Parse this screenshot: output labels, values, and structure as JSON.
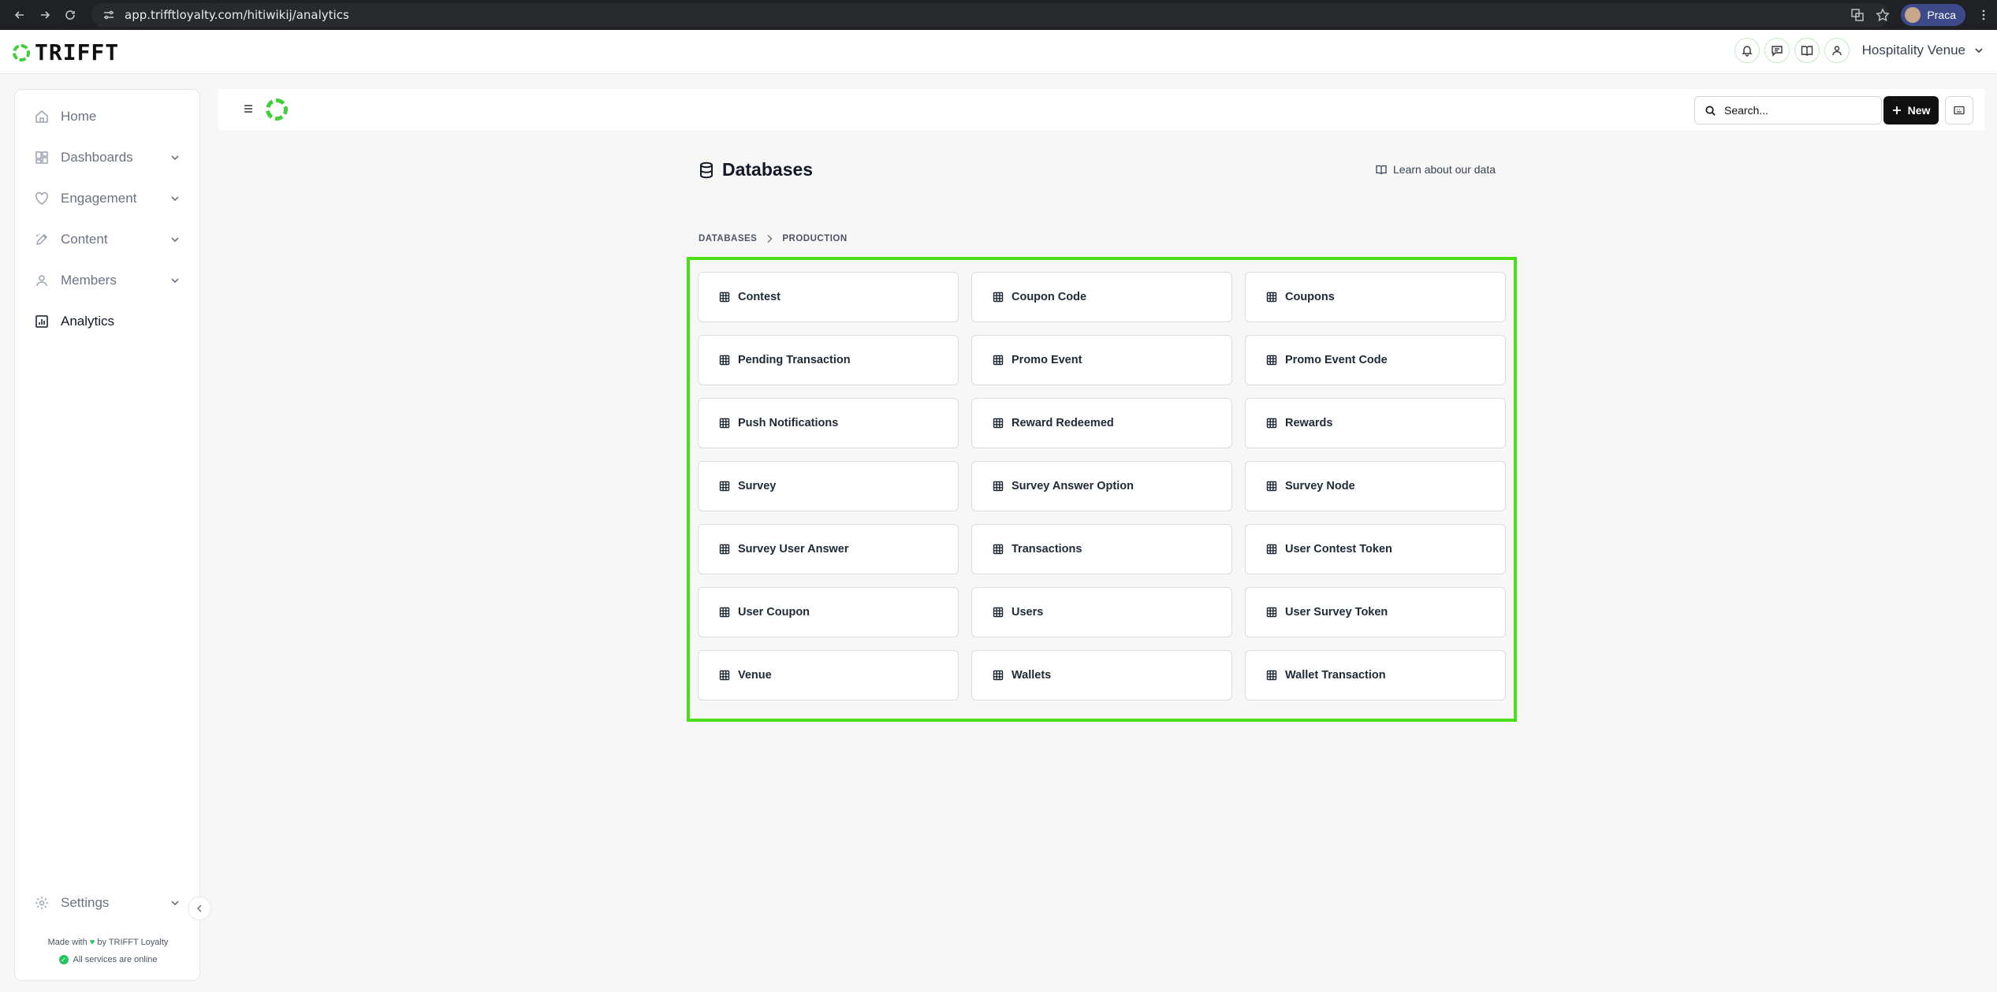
{
  "browser": {
    "url": "app.trifftloyalty.com/hitiwikij/analytics",
    "profile_name": "Praca"
  },
  "header": {
    "logo_text": "TRIFFT",
    "venue_name": "Hospitality Venue"
  },
  "sidebar": {
    "items": [
      {
        "label": "Home",
        "icon": "home-icon"
      },
      {
        "label": "Dashboards",
        "icon": "dashboard-icon"
      },
      {
        "label": "Engagement",
        "icon": "heart-icon"
      },
      {
        "label": "Content",
        "icon": "pen-icon"
      },
      {
        "label": "Members",
        "icon": "user-icon"
      },
      {
        "label": "Analytics",
        "icon": "chart-icon"
      }
    ],
    "settings_label": "Settings",
    "footer_made_with": "Made with",
    "footer_by": "by TRIFFT Loyalty",
    "footer_status": "All services are online"
  },
  "topbar": {
    "search_placeholder": "Search...",
    "new_label": "New"
  },
  "page": {
    "title": "Databases",
    "learn_link": "Learn about our data",
    "breadcrumb": [
      "DATABASES",
      "PRODUCTION"
    ]
  },
  "tables": [
    "Contest",
    "Coupon Code",
    "Coupons",
    "Pending Transaction",
    "Promo Event",
    "Promo Event Code",
    "Push Notifications",
    "Reward Redeemed",
    "Rewards",
    "Survey",
    "Survey Answer Option",
    "Survey Node",
    "Survey User Answer",
    "Transactions",
    "User Contest Token",
    "User Coupon",
    "Users",
    "User Survey Token",
    "Venue",
    "Wallets",
    "Wallet Transaction"
  ],
  "colors": {
    "brand_green": "#3ecf3a",
    "highlight_frame": "#4ade1a",
    "primary_button": "#111111"
  }
}
